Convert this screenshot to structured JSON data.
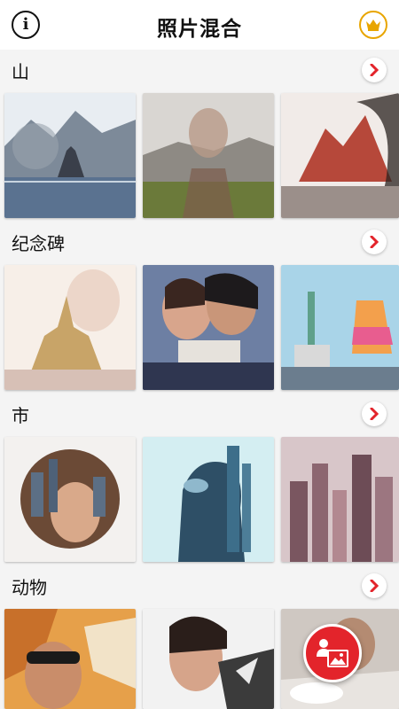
{
  "app": {
    "title": "照片混合"
  },
  "colors": {
    "accent": "#E3242B",
    "crown": "#E8A500",
    "section_bg": "#f4f4f4"
  },
  "header": {
    "info_icon": "info-icon",
    "premium_icon": "crown-icon"
  },
  "sections": [
    {
      "title": "山"
    },
    {
      "title": "纪念碑"
    },
    {
      "title": "市"
    },
    {
      "title": "动物"
    }
  ],
  "fab": {
    "icon": "add-photo-icon"
  }
}
